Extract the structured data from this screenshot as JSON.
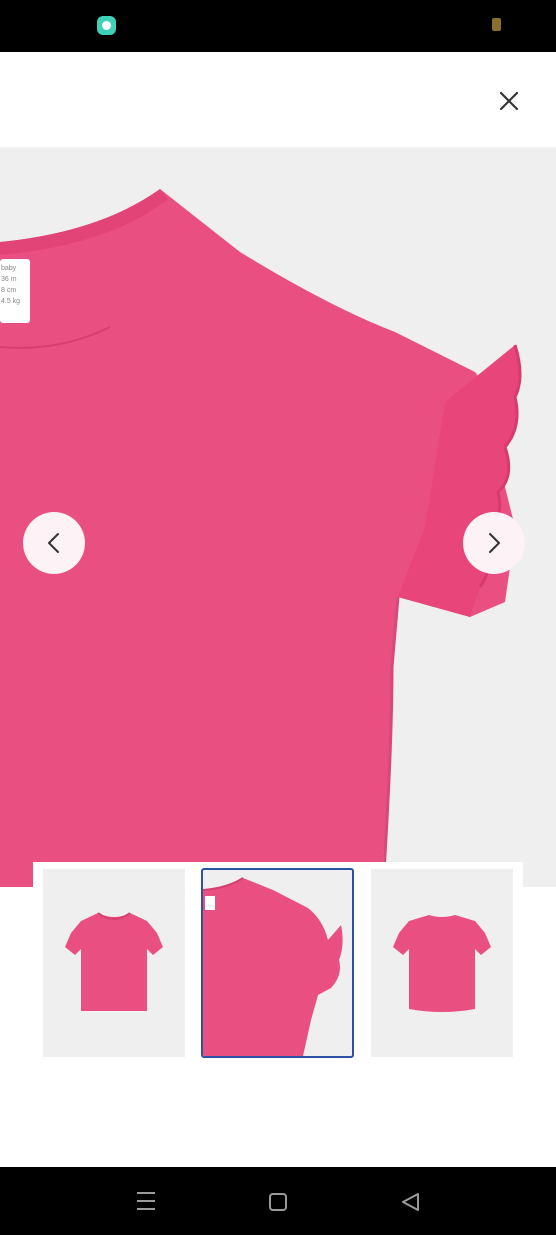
{
  "status_bar": {
    "left_icon": "chat-bubble-icon",
    "right_icon": "battery-icon"
  },
  "header": {
    "close_icon": "close-icon"
  },
  "gallery": {
    "main_image": {
      "label_lines": [
        "baby",
        "36 m",
        "8 cm",
        "4.5 kg"
      ]
    },
    "prev_icon": "chevron-left-icon",
    "next_icon": "chevron-right-icon",
    "thumbnails": [
      {
        "view": "front",
        "selected": false
      },
      {
        "view": "sleeve-detail",
        "selected": true
      },
      {
        "view": "back",
        "selected": false
      }
    ]
  },
  "colors": {
    "product_pink": "#ea4f81",
    "selected_border": "#2c53a3",
    "image_background": "#efeff0"
  },
  "system_nav": {
    "menu_icon": "menu-icon",
    "home_icon": "home-icon",
    "back_icon": "back-triangle-icon"
  }
}
